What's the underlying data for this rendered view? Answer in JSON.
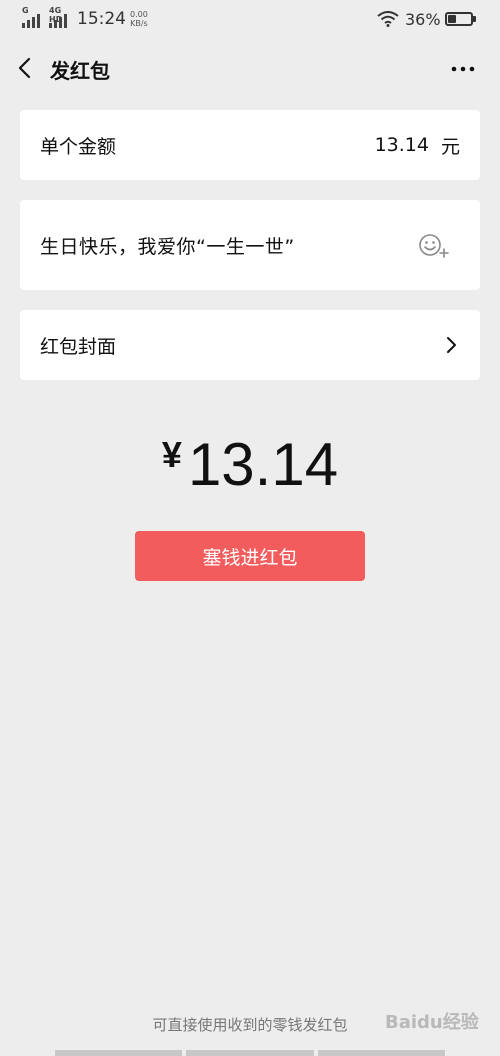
{
  "status_bar": {
    "signal1_label": "G",
    "signal2_label": "4G HD",
    "time": "15:24",
    "speed_value": "0.00",
    "speed_unit": "KB/s",
    "battery": "36%",
    "battery_level": 0.36
  },
  "nav": {
    "title": "发红包",
    "back_icon": "chevron-left-icon",
    "more_icon": "more-dots-icon"
  },
  "amount_row": {
    "label": "单个金额",
    "value": "13.14",
    "unit": "元"
  },
  "greeting": {
    "text": "生日快乐，我爱你“一生一世”",
    "emoji_icon": "emoji-add-icon"
  },
  "cover_row": {
    "label": "红包封面",
    "chevron_icon": "chevron-right-icon"
  },
  "total": {
    "currency": "¥",
    "amount": "13.14"
  },
  "submit_label": "塞钱进红包",
  "footer_note": "可直接使用收到的零钱发红包",
  "watermark": "Baidu经验",
  "colors": {
    "background": "#ededed",
    "card": "#ffffff",
    "submit": "#f35c5c"
  }
}
